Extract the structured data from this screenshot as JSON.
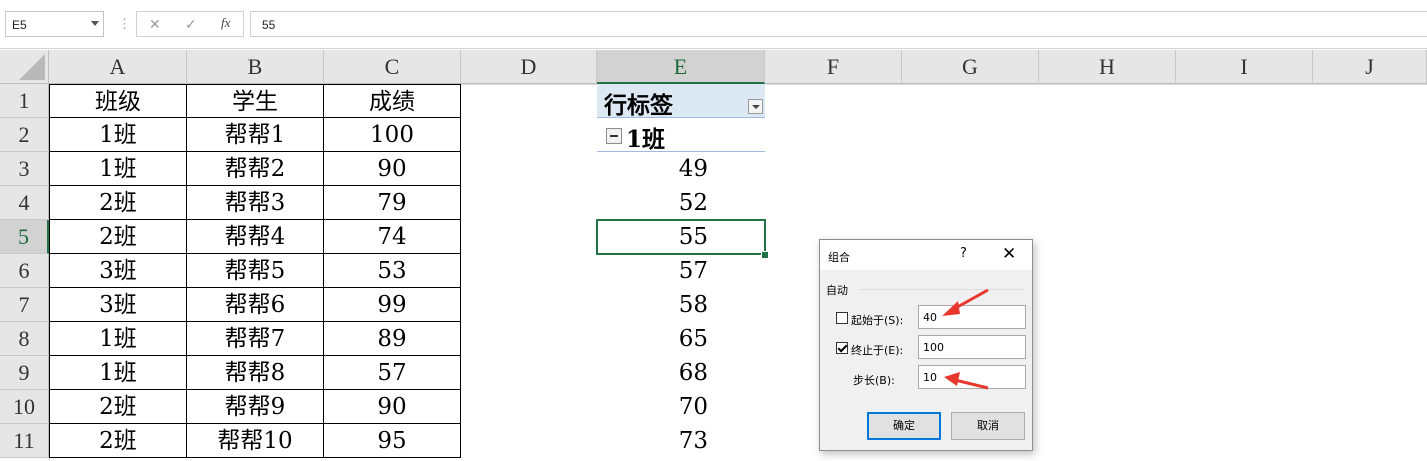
{
  "formula_bar": {
    "name_box": "E5",
    "cancel_icon": "✕",
    "enter_icon": "✓",
    "fx_label": "fx",
    "formula_value": "55"
  },
  "columns": [
    "A",
    "B",
    "C",
    "D",
    "E",
    "F",
    "G",
    "H",
    "I",
    "J"
  ],
  "rows": [
    "1",
    "2",
    "3",
    "4",
    "5",
    "6",
    "7",
    "8",
    "9",
    "10",
    "11"
  ],
  "table": {
    "headers": [
      "班级",
      "学生",
      "成绩"
    ],
    "rows": [
      [
        "1班",
        "帮帮1",
        "100"
      ],
      [
        "1班",
        "帮帮2",
        "90"
      ],
      [
        "2班",
        "帮帮3",
        "79"
      ],
      [
        "2班",
        "帮帮4",
        "74"
      ],
      [
        "3班",
        "帮帮5",
        "53"
      ],
      [
        "3班",
        "帮帮6",
        "99"
      ],
      [
        "1班",
        "帮帮7",
        "89"
      ],
      [
        "1班",
        "帮帮8",
        "57"
      ],
      [
        "2班",
        "帮帮9",
        "90"
      ],
      [
        "2班",
        "帮帮10",
        "95"
      ]
    ]
  },
  "pivot": {
    "header": "行标签",
    "group": "1班",
    "values": [
      "49",
      "52",
      "55",
      "57",
      "58",
      "65",
      "68",
      "70",
      "73"
    ]
  },
  "dialog": {
    "title": "组合",
    "help": "?",
    "close": "✕",
    "section": "自动",
    "start_label": "起始于(S):",
    "start_checked": false,
    "start_value": "40",
    "end_label": "终止于(E):",
    "end_checked": true,
    "end_value": "100",
    "step_label": "步长(B):",
    "step_value": "10",
    "ok": "确定",
    "cancel": "取消"
  },
  "colors": {
    "accent_green": "#217346",
    "pivot_header_bg": "#dde8f5",
    "arrow_red": "#e8382e"
  },
  "selection": {
    "active_column": "E",
    "active_row": "5"
  }
}
